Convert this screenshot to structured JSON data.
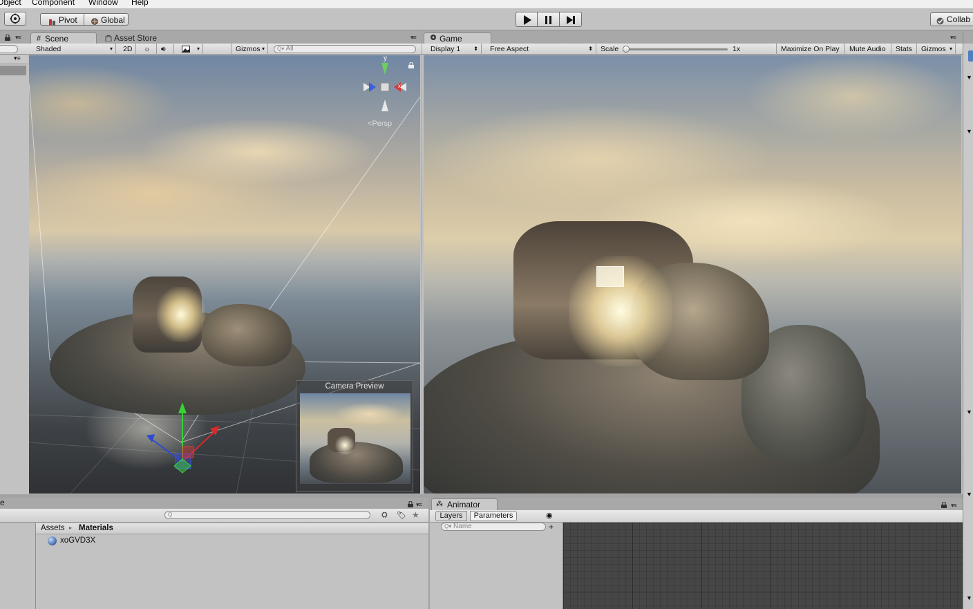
{
  "menubar": {
    "items": [
      "Object",
      "Component",
      "Window",
      "Help"
    ]
  },
  "toolbar": {
    "pivot_label": "Pivot",
    "global_label": "Global",
    "play_icon": "play-icon",
    "pause_icon": "pause-icon",
    "step_icon": "step-icon",
    "collab_label": "Collab"
  },
  "scene_panel": {
    "tabs": [
      "Scene",
      "Asset Store"
    ],
    "shading_mode": "Shaded",
    "mode_2d": "2D",
    "gizmos_label": "Gizmos",
    "search_placeholder": "All",
    "gizmo_axis_y": "y",
    "gizmo_axis_x": "x",
    "persp_label": "Persp",
    "camera_preview_title": "Camera Preview"
  },
  "game_panel": {
    "tab": "Game",
    "display": "Display 1",
    "aspect": "Free Aspect",
    "scale_label": "Scale",
    "scale_value": "1x",
    "scale_fraction": 0.0,
    "maximize_label": "Maximize On Play",
    "mute_label": "Mute Audio",
    "stats_label": "Stats",
    "gizmos_label": "Gizmos"
  },
  "project_panel": {
    "tab_fragment": "e",
    "breadcrumb": [
      "Assets",
      "Materials"
    ],
    "items": [
      {
        "name": "xoGVD3X",
        "icon": "material-sphere-icon"
      }
    ]
  },
  "animator_panel": {
    "tab": "Animator",
    "subtabs": [
      "Layers",
      "Parameters"
    ],
    "search_placeholder": "Name"
  },
  "colors": {
    "panel_bg": "#c2c2c2",
    "tab_strip": "#a8a8a8",
    "grid_bg": "#464646",
    "gizmo_green": "#3ad13a",
    "gizmo_red": "#d62b2b",
    "gizmo_blue": "#2b4ad6"
  }
}
